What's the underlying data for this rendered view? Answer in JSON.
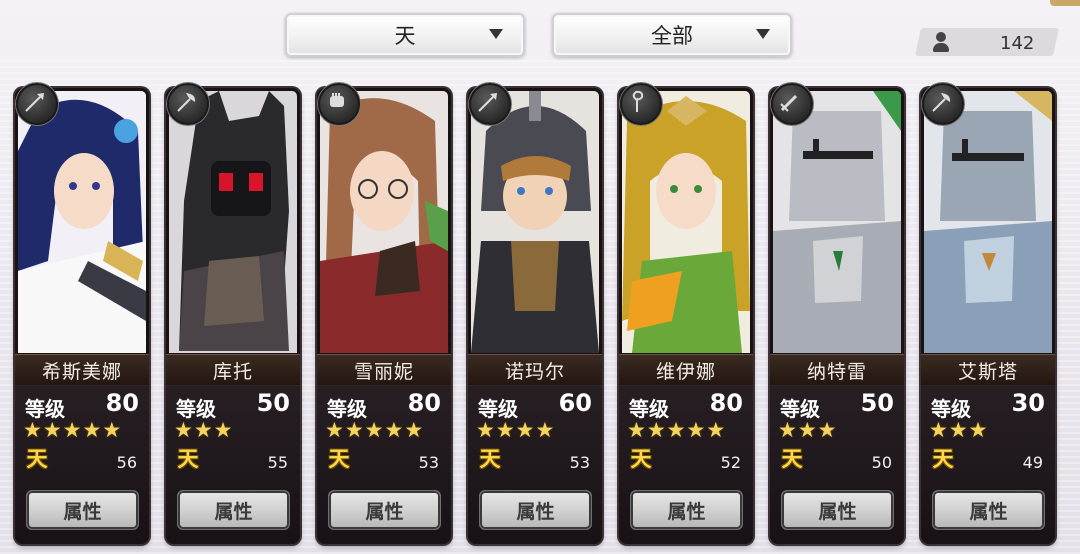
{
  "filters": {
    "rarity": "天",
    "category": "全部"
  },
  "roster_count": "142",
  "tier_glyph": "天",
  "attr_label": "属性",
  "level_label": "等级",
  "cards": [
    {
      "name": "希斯美娜",
      "level": "80",
      "stars": 5,
      "power": "56",
      "weapon": "spear-icon",
      "theme": "#1f2a6b"
    },
    {
      "name": "库托",
      "level": "50",
      "stars": 3,
      "power": "55",
      "weapon": "axe-icon",
      "theme": "#2a2a2a"
    },
    {
      "name": "雪丽妮",
      "level": "80",
      "stars": 5,
      "power": "53",
      "weapon": "fist-icon",
      "theme": "#8a2a2a"
    },
    {
      "name": "诺玛尔",
      "level": "60",
      "stars": 4,
      "power": "53",
      "weapon": "spear-icon",
      "theme": "#4a4a52"
    },
    {
      "name": "维伊娜",
      "level": "80",
      "stars": 5,
      "power": "52",
      "weapon": "staff-icon",
      "theme": "#c9a227"
    },
    {
      "name": "纳特雷",
      "level": "50",
      "stars": 3,
      "power": "50",
      "weapon": "sword-icon",
      "theme": "#b9bcc2"
    },
    {
      "name": "艾斯塔",
      "level": "30",
      "stars": 3,
      "power": "49",
      "weapon": "axe-icon",
      "theme": "#9aa6b4"
    }
  ]
}
